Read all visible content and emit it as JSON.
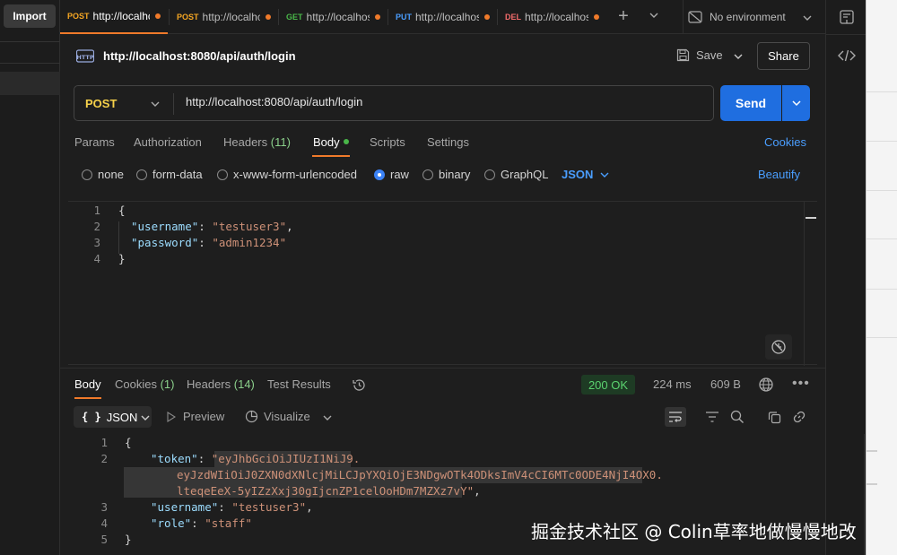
{
  "sidebar": {
    "import_label": "Import"
  },
  "tabs": [
    {
      "method": "POST",
      "method_color": "#f5a623",
      "url": "http://localhc"
    },
    {
      "method": "POST",
      "method_color": "#f5a623",
      "url": "http://localhc"
    },
    {
      "method": "GET",
      "method_color": "#49b649",
      "url": "http://localhos"
    },
    {
      "method": "PUT",
      "method_color": "#4a9eff",
      "url": "http://localhos"
    },
    {
      "method": "DEL",
      "method_color": "#f26b6b",
      "url": "http://localhos"
    }
  ],
  "environment": {
    "label": "No environment"
  },
  "request": {
    "title": "http://localhost:8080/api/auth/login",
    "save_label": "Save",
    "share_label": "Share",
    "method": "POST",
    "url": "http://localhost:8080/api/auth/login",
    "send_label": "Send"
  },
  "request_tabs": {
    "params": "Params",
    "authorization": "Authorization",
    "headers_label": "Headers",
    "headers_count": "(11)",
    "body": "Body",
    "scripts": "Scripts",
    "settings": "Settings",
    "cookies": "Cookies"
  },
  "body_types": {
    "none": "none",
    "form_data": "form-data",
    "urlencoded": "x-www-form-urlencoded",
    "raw": "raw",
    "binary": "binary",
    "graphql": "GraphQL",
    "format": "JSON",
    "beautify": "Beautify",
    "selected": "raw"
  },
  "request_body": {
    "line_numbers": [
      "1",
      "2",
      "3",
      "4"
    ],
    "open_brace": "{",
    "close_brace": "}",
    "k_username": "\"username\"",
    "v_username": "\"testuser3\"",
    "k_password": "\"password\"",
    "v_password": "\"admin1234\""
  },
  "response_tabs": {
    "body": "Body",
    "cookies_label": "Cookies",
    "cookies_count": "(1)",
    "headers_label": "Headers",
    "headers_count": "(14)",
    "test_results": "Test Results"
  },
  "response_meta": {
    "status": "200 OK",
    "time": "224 ms",
    "size": "609 B"
  },
  "response_toolbar": {
    "format": "JSON",
    "format_brace": "{ }",
    "preview": "Preview",
    "visualize": "Visualize"
  },
  "response_body": {
    "line_numbers": [
      "1",
      "2",
      "",
      "",
      "3",
      "4",
      "5"
    ],
    "open_brace": "{",
    "close_brace": "}",
    "k_token": "\"token\"",
    "token_line1": "\"eyJhbGciOiJIUzI1NiJ9.",
    "token_line2": "eyJzdWIiOiJ0ZXN0dXNlcjMiLCJpYXQiOjE3NDgwOTk4ODksImV4cCI6MTc0ODE4NjI4OX0.",
    "token_line3": "lteqeEeX-5yIZzXxj30gIjcnZP1celOoHDm7MZXz7vY\"",
    "k_username": "\"username\"",
    "v_username": "\"testuser3\"",
    "k_role": "\"role\"",
    "v_role": "\"staff\""
  },
  "watermark": "掘金技术社区 @ Colin草率地做慢慢地改"
}
